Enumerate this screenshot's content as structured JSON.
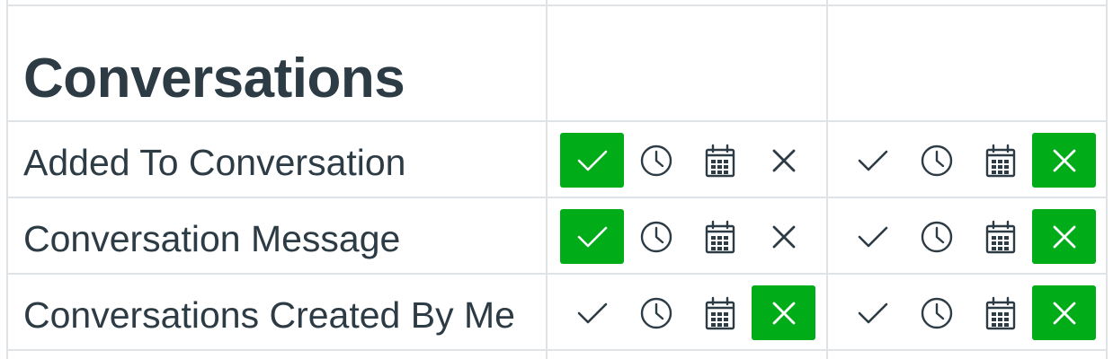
{
  "section": {
    "title": "Conversations"
  },
  "colors": {
    "selected": "#00ac18",
    "icon": "#2d3b45",
    "grid": "#e0e3e6"
  },
  "option_icons": [
    "check-icon",
    "clock-icon",
    "calendar-icon",
    "x-icon"
  ],
  "option_meanings": [
    "immediately",
    "daily",
    "weekly",
    "never"
  ],
  "rows": [
    {
      "label": "Added To Conversation",
      "columns": [
        {
          "selected": "check"
        },
        {
          "selected": "x"
        }
      ]
    },
    {
      "label": "Conversation Message",
      "columns": [
        {
          "selected": "check"
        },
        {
          "selected": "x"
        }
      ]
    },
    {
      "label": "Conversations Created By Me",
      "columns": [
        {
          "selected": "x"
        },
        {
          "selected": "x"
        }
      ]
    }
  ]
}
